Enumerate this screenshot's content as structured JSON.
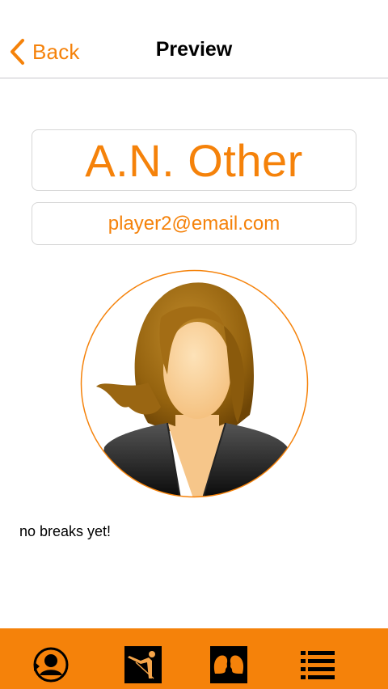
{
  "navbar": {
    "back_label": "Back",
    "title": "Preview"
  },
  "profile": {
    "name": "A.N. Other",
    "email": "player2@email.com"
  },
  "breaks_text": "no breaks yet!",
  "tabs": [
    {
      "icon": "player-profile-icon"
    },
    {
      "icon": "snooker-player-icon"
    },
    {
      "icon": "head-to-head-icon"
    },
    {
      "icon": "list-icon"
    }
  ],
  "colors": {
    "accent": "#f5820a",
    "tabbar": "#f5820a",
    "border": "#d6d6d6"
  }
}
